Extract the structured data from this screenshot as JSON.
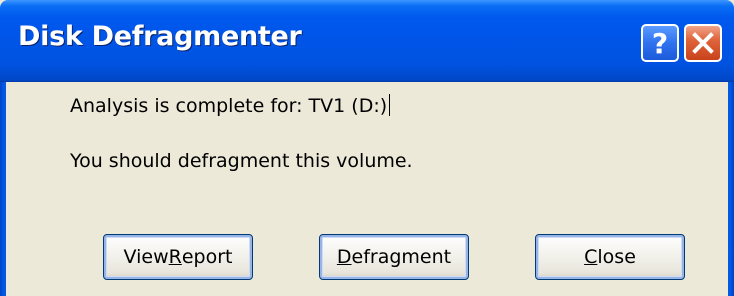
{
  "window": {
    "title": "Disk Defragmenter",
    "title_buttons": {
      "help_label": "?",
      "help_icon": "help-icon",
      "close_icon": "close-x-icon"
    }
  },
  "message": {
    "line1": "Analysis is complete for: TV1 (D:)",
    "line2": "You should defragment this volume."
  },
  "buttons": {
    "view_report": {
      "pre": "View ",
      "accel": "R",
      "post": "eport"
    },
    "defragment": {
      "pre": "",
      "accel": "D",
      "post": "efragment"
    },
    "close": {
      "pre": "",
      "accel": "C",
      "post": "lose"
    }
  },
  "colors": {
    "titlebar": "#0055e8",
    "dialog_bg": "#ece9d8",
    "close_button": "#e0653c",
    "help_button": "#2f72f0"
  }
}
